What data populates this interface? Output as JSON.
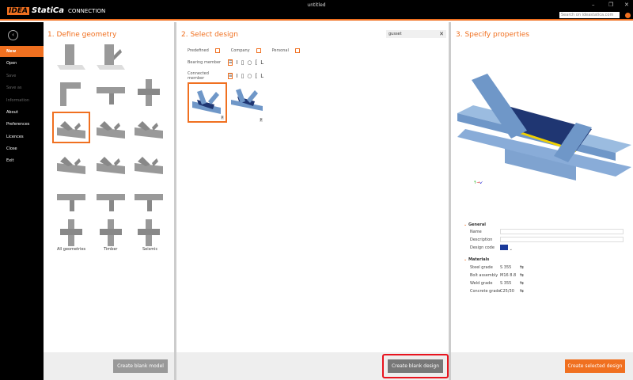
{
  "app": {
    "logo_brand": "IDEA",
    "logo_name": "StatiCa",
    "product": "CONNECTION",
    "window_title": "untitled",
    "web_search_placeholder": "Search on ideastatica.com"
  },
  "sidebar": {
    "items": [
      {
        "label": "New",
        "active": true
      },
      {
        "label": "Open"
      },
      {
        "label": "Save",
        "disabled": true
      },
      {
        "label": "Save as",
        "disabled": true
      },
      {
        "label": "Information",
        "disabled": true
      },
      {
        "label": "About"
      },
      {
        "label": "Preferences"
      },
      {
        "label": "Licences"
      },
      {
        "label": "Close"
      },
      {
        "label": "Exit"
      }
    ]
  },
  "geometry": {
    "title": "1. Define geometry",
    "categories": [
      "All geometries",
      "Timber",
      "Seismic"
    ],
    "create_blank_model": "Create blank model"
  },
  "design": {
    "title": "2. Select design",
    "search_value": "gusset",
    "filters": [
      "Predefined",
      "Company",
      "Personal"
    ],
    "bearing_member": "Bearing member",
    "connected_member": "Connected member",
    "badge": "P",
    "create_blank_design": "Create blank design"
  },
  "properties": {
    "title": "3. Specify properties",
    "general": "General",
    "name_label": "Name",
    "description_label": "Description",
    "design_code_label": "Design code",
    "materials": "Materials",
    "material_rows": [
      {
        "label": "Steel grade",
        "value": "S 355"
      },
      {
        "label": "Bolt assembly",
        "value": "M16 8.8"
      },
      {
        "label": "Weld grade",
        "value": "S 355"
      },
      {
        "label": "Concrete grade",
        "value": "C25/30"
      }
    ],
    "create_selected_design": "Create selected design"
  },
  "colors": {
    "accent": "#f07020",
    "highlight": "#e8141e"
  }
}
